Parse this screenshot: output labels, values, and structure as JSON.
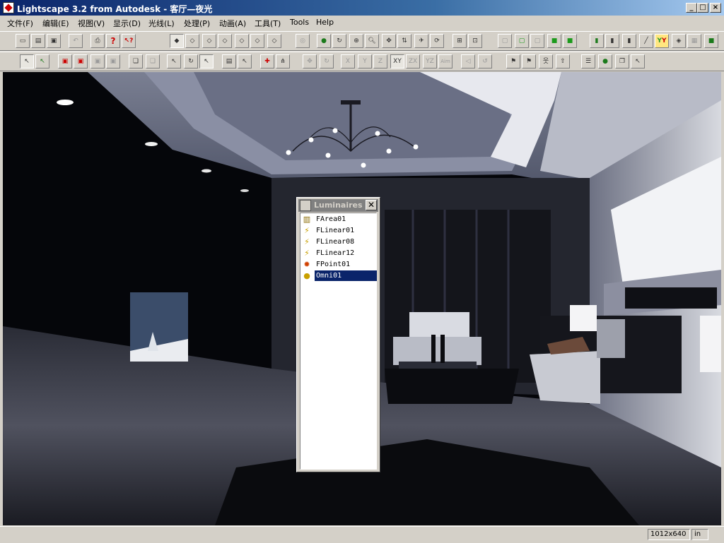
{
  "window": {
    "title": "Lightscape 3.2 from Autodesk - 客厅—夜光",
    "minimize_glyph": "_",
    "maximize_glyph": "□",
    "close_glyph": "×"
  },
  "menu": [
    {
      "label": "文件(F)"
    },
    {
      "label": "编辑(E)"
    },
    {
      "label": "视图(V)"
    },
    {
      "label": "显示(D)"
    },
    {
      "label": "光线(L)"
    },
    {
      "label": "处理(P)"
    },
    {
      "label": "动画(A)"
    },
    {
      "label": "工具(T)"
    },
    {
      "label": "Tools"
    },
    {
      "label": "Help"
    }
  ],
  "toolbar2_axes": [
    "X",
    "Y",
    "Z",
    "XY",
    "ZX",
    "YZ",
    "Aim"
  ],
  "luminaires_palette": {
    "title": "Luminaires",
    "close_glyph": "✕",
    "items": [
      {
        "name": "FArea01",
        "icon": "area-light-icon"
      },
      {
        "name": "FLinear01",
        "icon": "linear-light-icon"
      },
      {
        "name": "FLinear08",
        "icon": "linear-light-icon"
      },
      {
        "name": "FLinear12",
        "icon": "linear-light-icon"
      },
      {
        "name": "FPoint01",
        "icon": "point-light-icon"
      },
      {
        "name": "Omni01",
        "icon": "omni-light-icon",
        "selected": true
      }
    ]
  },
  "status": {
    "resolution": "1012x640",
    "units": "in"
  },
  "colors": {
    "titlebar_start": "#0a246a",
    "titlebar_end": "#a6caf0",
    "selection": "#0a246a",
    "chrome": "#d4d0c8"
  }
}
